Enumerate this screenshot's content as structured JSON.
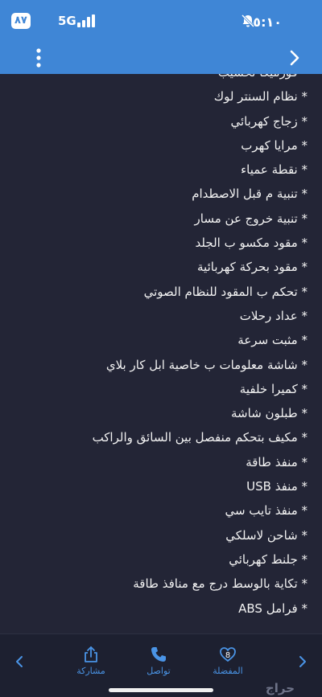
{
  "status_bar": {
    "time": "٥:١٠",
    "network": "5G",
    "battery": "٨٧",
    "icons": [
      "bell-muted-icon",
      "signal-icon"
    ]
  },
  "nav": {
    "menu_icon": "kebab-menu-icon",
    "back_icon": "chevron-right-icon"
  },
  "features": [
    "* فورميكا تخشيب",
    "* نظام السنتر لوك",
    "* زجاج كهربائي",
    "* مرايا كهرب",
    "* نقطة عمياء",
    "* تنبية م قبل الاصطدام",
    "* تنبية خروج عن مسار",
    "* مقود مكسو ب الجلد",
    "* مقود بحركة كهربائية",
    "* تحكم ب المقود للنظام الصوتي",
    "* عداد رحلات",
    "* مثبت سرعة",
    "* شاشة معلومات ب خاصية ابل كار بلاي",
    "* كميرا خلفية",
    "* طبلون شاشة",
    "* مكيف بتحكم منفصل بين السائق والراكب",
    "* منفذ طاقة",
    "* منفذ USB",
    "* منفذ تايب سي",
    "* شاحن لاسلكي",
    "* جلنط كهربائي",
    "* تكاية بالوسط درج مع منافذ طاقة",
    "* فرامل ABS"
  ],
  "bottom_bar": {
    "share_label": "مشاركة",
    "contact_label": "تواصل",
    "favorite_label": "المفضلة",
    "favorite_count": "8",
    "logo": "حراج",
    "accent_color": "#4a94e6",
    "header_color": "#3f86d6",
    "background_color": "#232536"
  }
}
